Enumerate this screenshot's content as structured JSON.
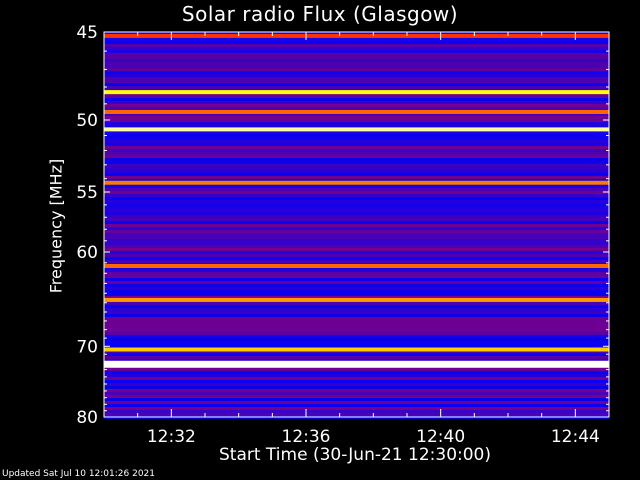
{
  "chart_data": {
    "type": "heatmap",
    "title": "Solar radio Flux (Glasgow)",
    "xlabel": "Start Time (30-Jun-21 12:30:00)",
    "ylabel": "Frequency [MHz]",
    "x_ticks": [
      "12:32",
      "12:36",
      "12:40",
      "12:44"
    ],
    "x_tick_minutes": [
      2,
      6,
      10,
      14
    ],
    "xlim_minutes": [
      0,
      15
    ],
    "y_ticks": [
      45,
      50,
      55,
      60,
      70,
      80
    ],
    "ylim": [
      45,
      80
    ],
    "y_scale": "reciprocal",
    "colormap": [
      "#000080",
      "#0000ff",
      "#ff0000",
      "#ffff00",
      "#ffffff"
    ],
    "bands": [
      {
        "freq": 45.2,
        "intensity": 0.55
      },
      {
        "freq": 48.3,
        "intensity": 0.75
      },
      {
        "freq": 49.5,
        "intensity": 0.6
      },
      {
        "freq": 50.6,
        "intensity": 0.9
      },
      {
        "freq": 54.3,
        "intensity": 0.62
      },
      {
        "freq": 61.3,
        "intensity": 0.6
      },
      {
        "freq": 64.7,
        "intensity": 0.65
      },
      {
        "freq": 70.4,
        "intensity": 0.7
      },
      {
        "freq": 72.3,
        "intensity": 1.0
      }
    ],
    "background_intensity": 0.3
  },
  "footer": {
    "updated": "Updated Sat Jul 10 12:01:26 2021"
  }
}
